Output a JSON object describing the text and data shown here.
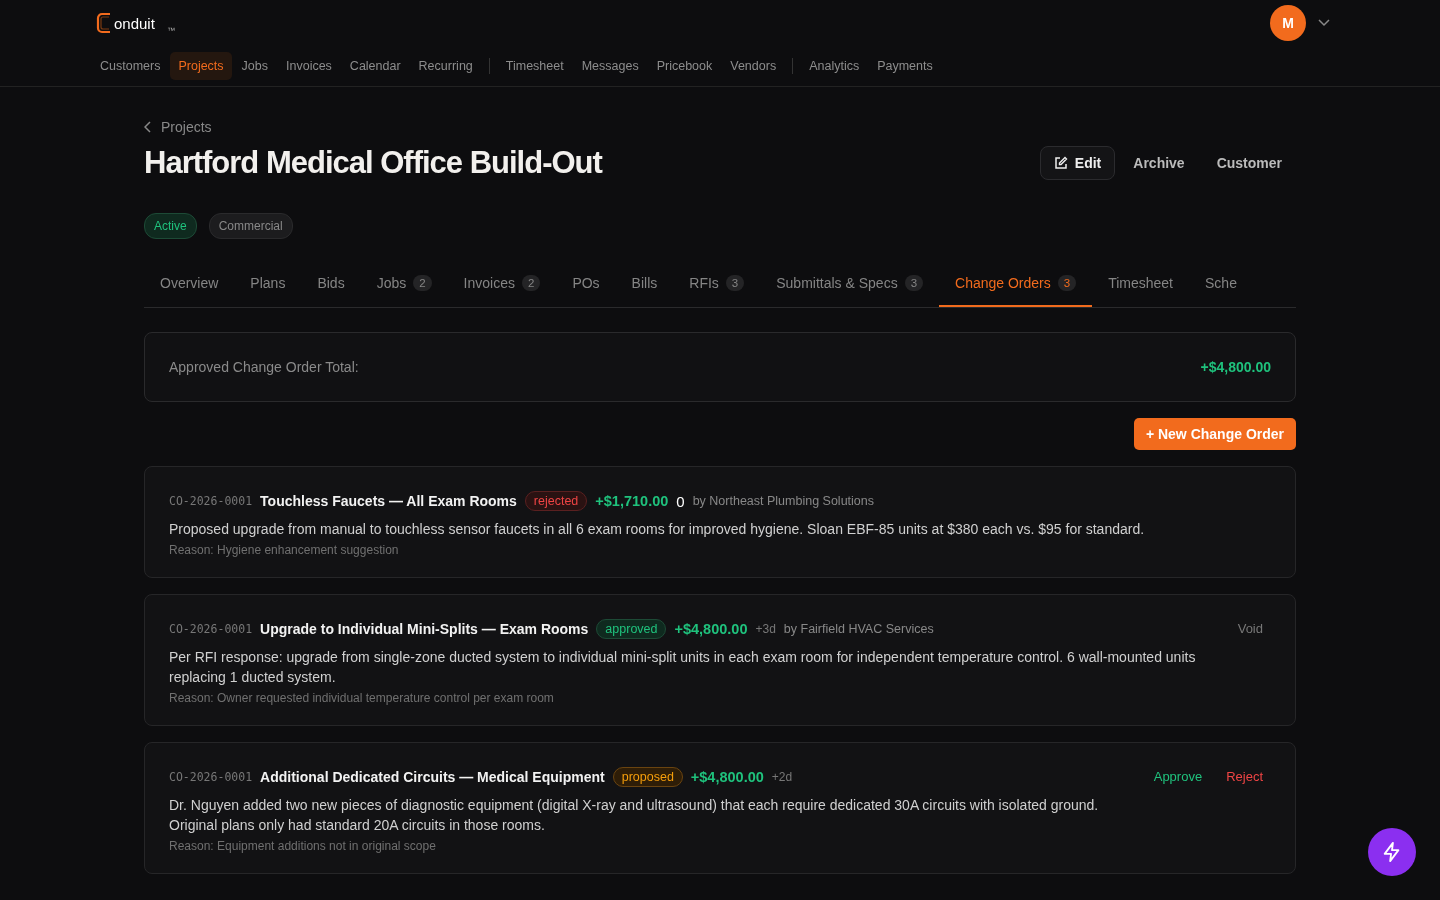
{
  "brand": {
    "name": "onduit",
    "trademark": "™"
  },
  "avatar": {
    "initial": "M"
  },
  "nav_groups": [
    [
      {
        "label": "Customers",
        "selected": false
      },
      {
        "label": "Projects",
        "selected": true
      },
      {
        "label": "Jobs",
        "selected": false
      },
      {
        "label": "Invoices",
        "selected": false
      },
      {
        "label": "Calendar",
        "selected": false
      },
      {
        "label": "Recurring",
        "selected": false
      }
    ],
    [
      {
        "label": "Timesheet",
        "selected": false
      },
      {
        "label": "Messages",
        "selected": false
      },
      {
        "label": "Pricebook",
        "selected": false
      },
      {
        "label": "Vendors",
        "selected": false
      }
    ],
    [
      {
        "label": "Analytics",
        "selected": false
      },
      {
        "label": "Payments",
        "selected": false
      }
    ]
  ],
  "breadcrumb": "Projects",
  "title": "Hartford Medical Office Build-Out",
  "actions": [
    {
      "label": "Edit",
      "kind": "outlined"
    },
    {
      "label": "Archive",
      "kind": "text"
    },
    {
      "label": "Customer",
      "kind": "text"
    }
  ],
  "tags": [
    {
      "label": "Active",
      "kind": "status"
    },
    {
      "label": "Commercial",
      "kind": "category"
    }
  ],
  "tabs": [
    {
      "label": "Overview",
      "selected": false
    },
    {
      "label": "Plans",
      "selected": false
    },
    {
      "label": "Bids",
      "selected": false
    },
    {
      "label": "Jobs",
      "count": "2",
      "selected": false
    },
    {
      "label": "Invoices",
      "count": "2",
      "selected": false
    },
    {
      "label": "POs",
      "selected": false
    },
    {
      "label": "Bills",
      "selected": false
    },
    {
      "label": "RFIs",
      "count": "3",
      "selected": false
    },
    {
      "label": "Submittals & Specs",
      "count": "3",
      "selected": false
    },
    {
      "label": "Change Orders",
      "count": "3",
      "selected": true
    },
    {
      "label": "Timesheet",
      "selected": false
    },
    {
      "label": "Sche",
      "selected": false
    }
  ],
  "summary": {
    "label": "Approved Change Order Total:",
    "value": "+$4,800.00"
  },
  "new_button": "+ New Change Order",
  "change_orders": [
    {
      "number": "CO-2026-0001",
      "title": "Touchless Faucets — All Exam Rooms",
      "status": "rejected",
      "amount": "+$1,710.00",
      "duration": {
        "text": "0",
        "emphasis": true
      },
      "vendor": "by Northeast Plumbing Solutions",
      "description": "Proposed upgrade from manual to touchless sensor faucets in all 6 exam rooms for improved hygiene. Sloan EBF-85 units at $380 each vs. $95 for standard.",
      "reason": "Reason: Hygiene enhancement suggestion"
    },
    {
      "number": "CO-2026-0001",
      "title": "Upgrade to Individual Mini-Splits — Exam Rooms",
      "status": "approved",
      "amount": "+$4,800.00",
      "duration": {
        "text": "+3d",
        "emphasis": false
      },
      "vendor": "by Fairfield HVAC Services",
      "description": "Per RFI response: upgrade from single-zone ducted system to individual mini-split units in each exam room for independent temperature control. 6 wall-mounted units replacing 1 ducted system.",
      "reason": "Reason: Owner requested individual temperature control per exam room",
      "actions": [
        {
          "label": "Void",
          "kind": "neutral"
        }
      ]
    },
    {
      "number": "CO-2026-0001",
      "title": "Additional Dedicated Circuits — Medical Equipment",
      "status": "proposed",
      "amount": "+$4,800.00",
      "duration": {
        "text": "+2d",
        "emphasis": false
      },
      "description": "Dr. Nguyen added two new pieces of diagnostic equipment (digital X-ray and ultrasound) that each require dedicated 30A circuits with isolated ground. Original plans only had standard 20A circuits in those rooms.",
      "reason": "Reason: Equipment additions not in original scope",
      "actions": [
        {
          "label": "Approve",
          "kind": "positive"
        },
        {
          "label": "Reject",
          "kind": "negative"
        }
      ]
    }
  ]
}
